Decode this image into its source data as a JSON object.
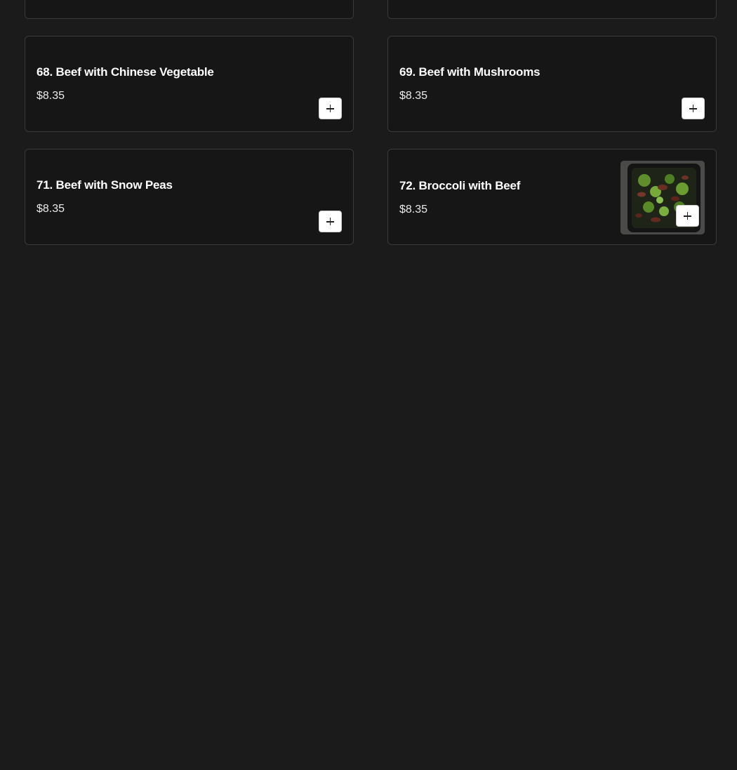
{
  "menu": {
    "items": [
      {
        "title": "68. Beef with Chinese Vegetable",
        "price": "$8.35",
        "add_icon": "plus-icon"
      },
      {
        "title": "69. Beef with Mushrooms",
        "price": "$8.35",
        "add_icon": "plus-icon"
      },
      {
        "title": "71. Beef with Snow Peas",
        "price": "$8.35",
        "add_icon": "plus-icon"
      },
      {
        "title": "72. Broccoli with Beef",
        "price": "$8.35",
        "add_icon": "plus-icon",
        "image": "broccoli-beef-photo"
      }
    ]
  },
  "colors": {
    "background": "#1b1b1b",
    "card_background": "#161616",
    "card_border": "#3a3a3a",
    "text": "#ffffff",
    "button_background": "#ffffff"
  }
}
